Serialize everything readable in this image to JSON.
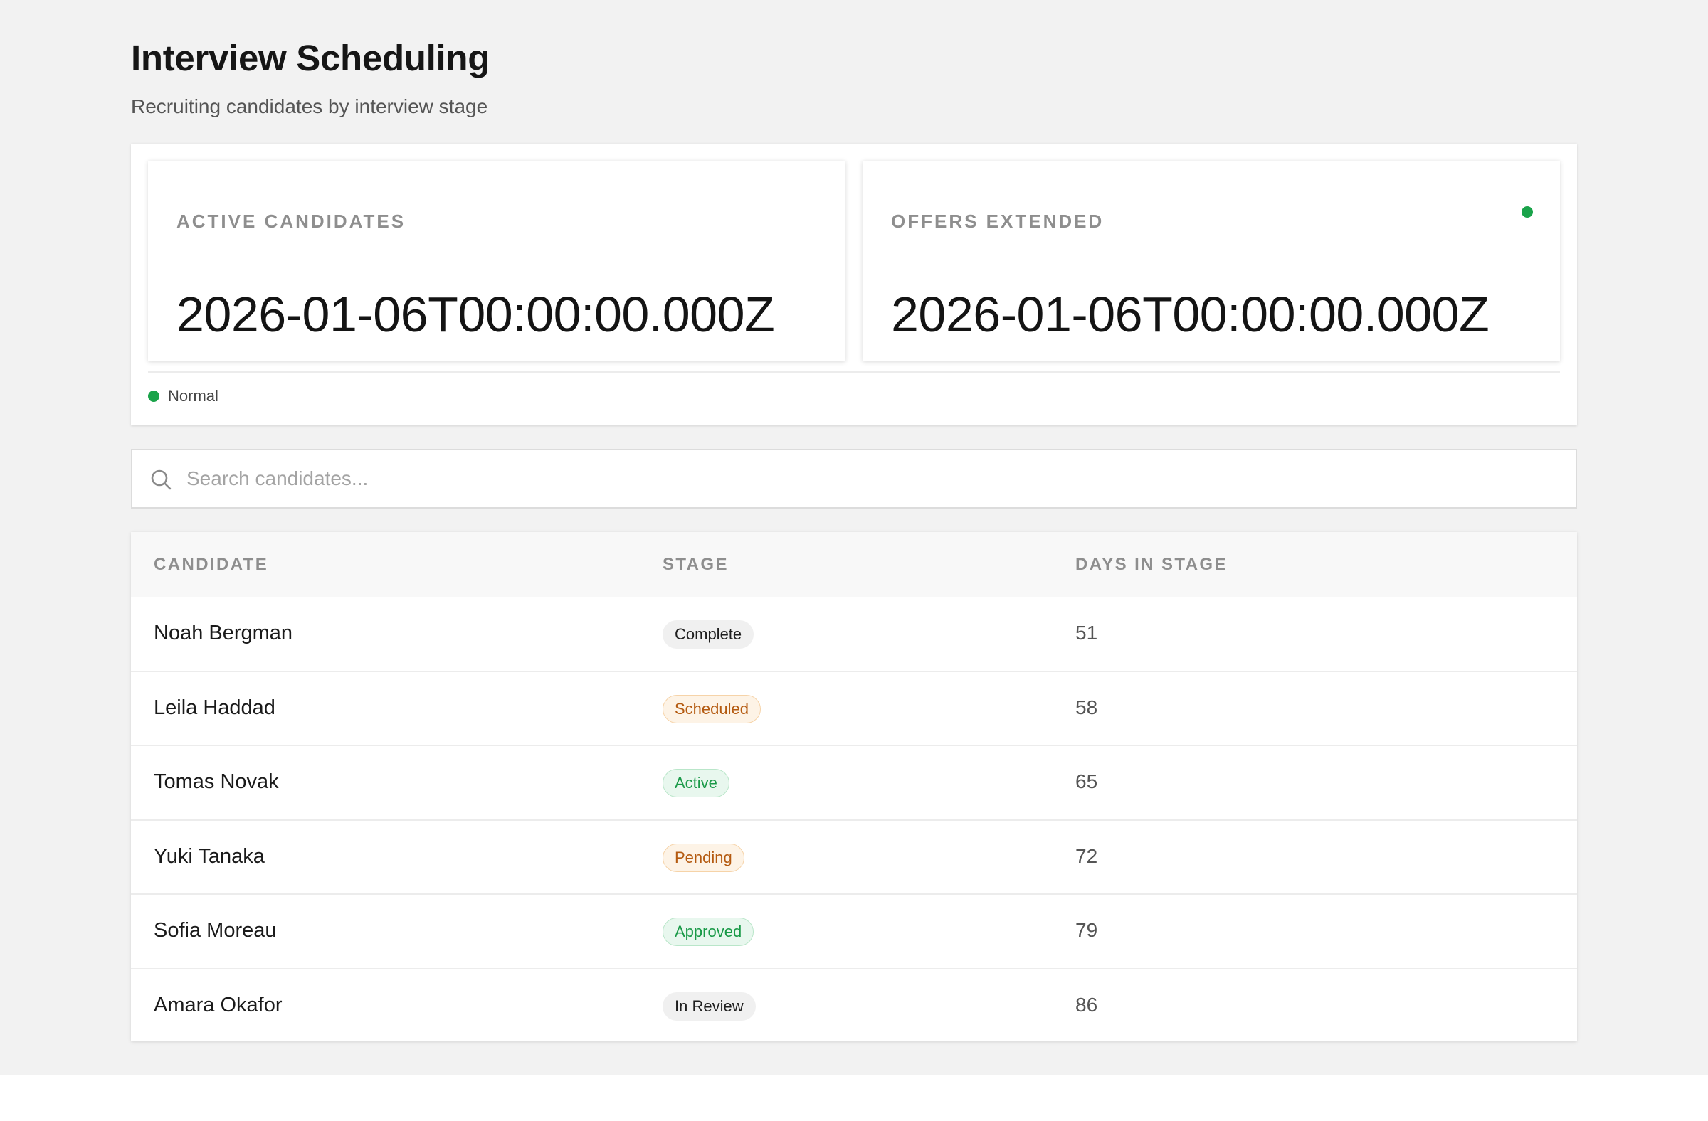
{
  "header": {
    "title": "Interview Scheduling",
    "subtitle": "Recruiting candidates by interview stage"
  },
  "kpis": [
    {
      "label": "ACTIVE CANDIDATES",
      "value": "2026-01-06T00:00:00.000Z",
      "status_dot": false
    },
    {
      "label": "OFFERS EXTENDED",
      "value": "2026-01-06T00:00:00.000Z",
      "status_dot": true,
      "status_color": "#1aa34a"
    }
  ],
  "legend": {
    "label": "Normal",
    "color": "#1aa34a"
  },
  "search": {
    "placeholder": "Search candidates...",
    "value": "",
    "icon": "search-icon"
  },
  "table": {
    "columns": [
      "CANDIDATE",
      "STAGE",
      "DAYS IN STAGE"
    ],
    "rows": [
      {
        "name": "Noah Bergman",
        "stage": "Complete",
        "stage_tone": "neutral",
        "days": "51"
      },
      {
        "name": "Leila Haddad",
        "stage": "Scheduled",
        "stage_tone": "warning",
        "days": "58"
      },
      {
        "name": "Tomas Novak",
        "stage": "Active",
        "stage_tone": "success",
        "days": "65"
      },
      {
        "name": "Yuki Tanaka",
        "stage": "Pending",
        "stage_tone": "warning",
        "days": "72"
      },
      {
        "name": "Sofia Moreau",
        "stage": "Approved",
        "stage_tone": "success",
        "days": "79"
      },
      {
        "name": "Amara Okafor",
        "stage": "In Review",
        "stage_tone": "neutral",
        "days": "86"
      }
    ]
  },
  "colors": {
    "page_background": "#f2f2f2",
    "status_green": "#1aa34a",
    "warning_text": "#b45a10",
    "success_text": "#1a9a48"
  }
}
